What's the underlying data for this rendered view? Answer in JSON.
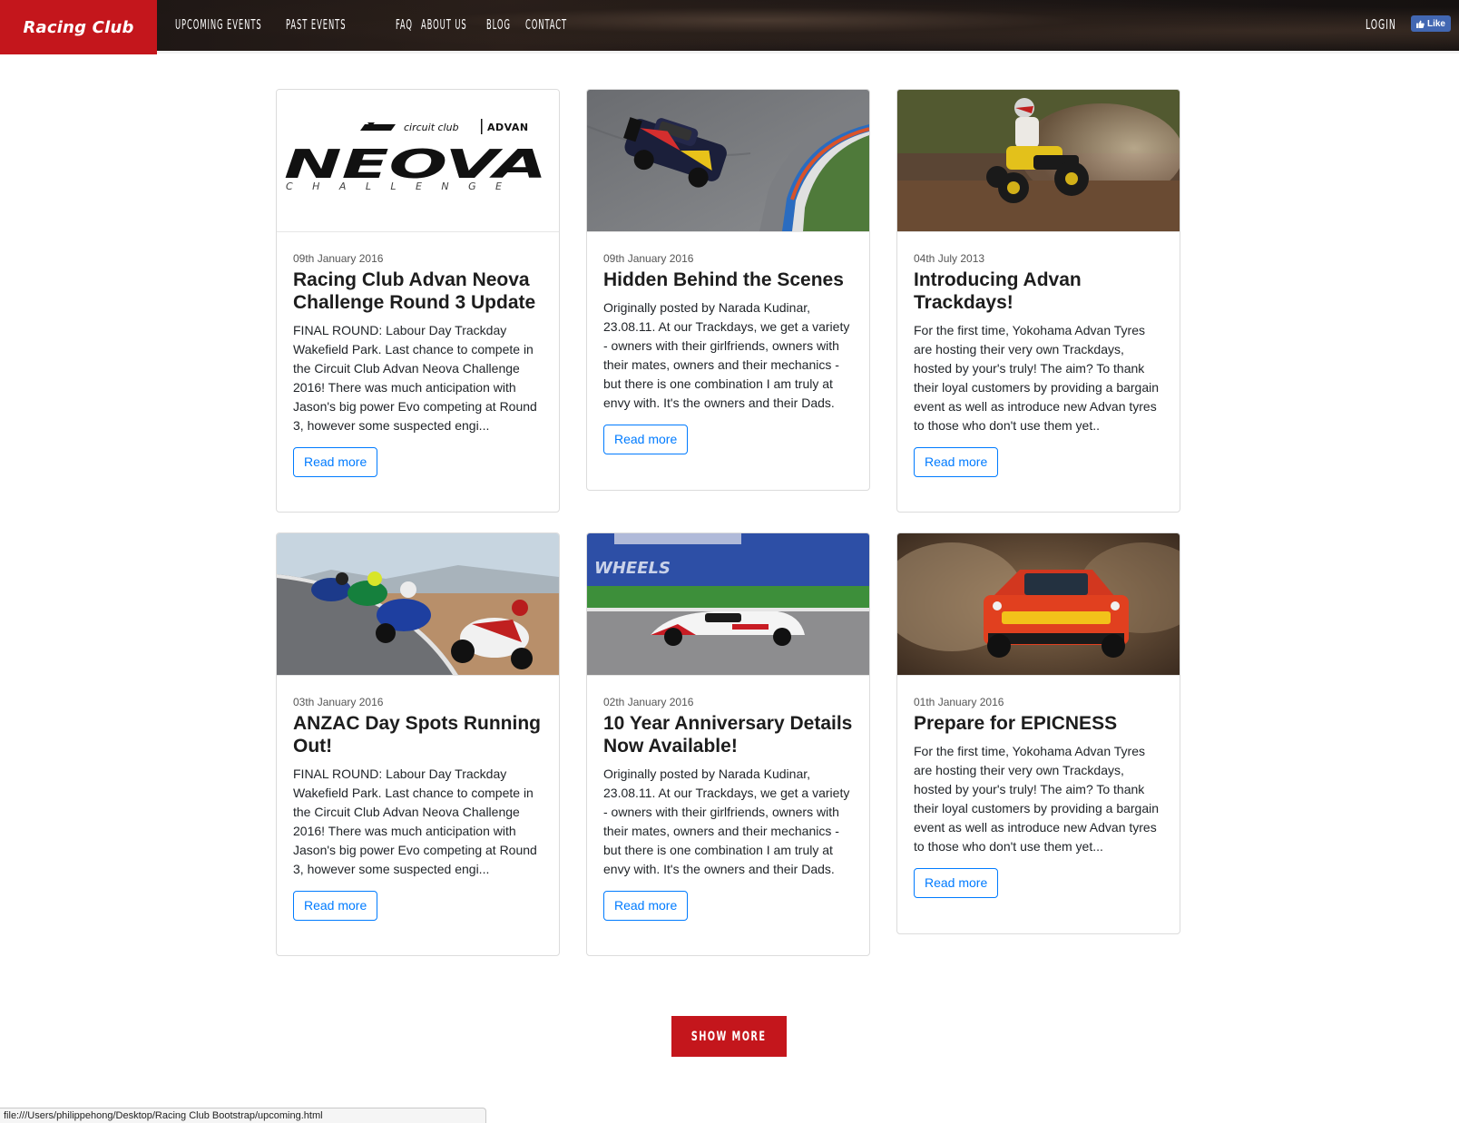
{
  "header": {
    "brand": "Racing Club",
    "nav": [
      "UPCOMING EVENTS",
      "PAST EVENTS",
      "FAQ",
      "ABOUT US",
      "BLOG",
      "CONTACT"
    ],
    "login": "LOGIN",
    "fb_like": "Like"
  },
  "cards": [
    {
      "date": "09th January 2016",
      "title": "Racing Club Advan Neova Challenge Round 3 Update",
      "text": "FINAL ROUND: Labour Day Trackday Wakefield Park. Last chance to compete in the Circuit Club Advan Neova Challenge 2016! There was much anticipation with Jason's big power Evo competing at Round 3, however some suspected engi...",
      "button": "Read more",
      "logo": {
        "line1_left": "circuit club",
        "line1_right": "ADVAN",
        "main": "NEOVA",
        "sub": "CHALLENGE"
      }
    },
    {
      "date": "09th January 2016",
      "title": "Hidden Behind the Scenes",
      "text": "Originally posted by Narada Kudinar, 23.08.11. At our Trackdays, we get a variety - owners with their girlfriends, owners with their mates, owners and their mechanics - but there is one combination I am truly at envy with. It's the owners and their Dads.",
      "button": "Read more"
    },
    {
      "date": "04th July 2013",
      "title": "Introducing Advan Trackdays!",
      "text": "For the first time, Yokohama Advan Tyres are hosting their very own Trackdays, hosted by your's truly! The aim? To thank their loyal customers by providing a bargain event as well as introduce new Advan tyres to those who don't use them yet..",
      "button": "Read more"
    },
    {
      "date": "03th January 2016",
      "title": "ANZAC Day Spots Running Out!",
      "text": "FINAL ROUND: Labour Day Trackday Wakefield Park. Last chance to compete in the Circuit Club Advan Neova Challenge 2016! There was much anticipation with Jason's big power Evo competing at Round 3, however some suspected engi...",
      "button": "Read more"
    },
    {
      "date": "02th January 2016",
      "title": "10 Year Anniversary Details Now Available!",
      "text": "Originally posted by Narada Kudinar, 23.08.11. At our Trackdays, we get a variety - owners with their girlfriends, owners with their mates, owners and their mechanics - but there is one combination I am truly at envy with. It's the owners and their Dads.",
      "button": "Read more",
      "image_text": "WHEELS"
    },
    {
      "date": "01th January 2016",
      "title": "Prepare for EPICNESS",
      "text": "For the first time, Yokohama Advan Tyres are hosting their very own Trackdays, hosted by your's truly! The aim? To thank their loyal customers by providing a bargain event as well as introduce new Advan tyres to those who don't use them yet...",
      "button": "Read more"
    }
  ],
  "show_more": "SHOW MORE",
  "status_url": "file:///Users/philippehong/Desktop/Racing Club Bootstrap/upcoming.html",
  "colors": {
    "brand_red": "#c4161c",
    "link_blue": "#007bff",
    "fb_blue": "#4267b2"
  }
}
